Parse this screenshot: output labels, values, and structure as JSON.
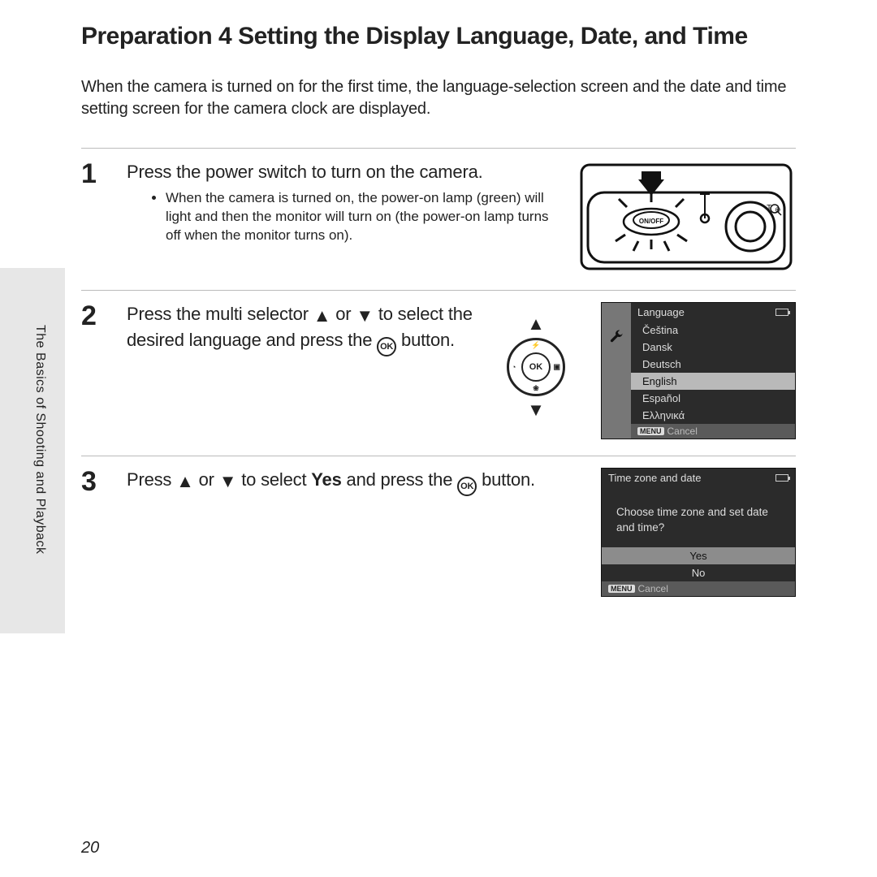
{
  "side_label": "The Basics of Shooting and Playback",
  "page_number": "20",
  "title": "Preparation 4 Setting the Display Language, Date, and Time",
  "intro": "When the camera is turned on for the first time, the language-selection screen and the date and time setting screen for the camera clock are displayed.",
  "steps": {
    "s1": {
      "num": "1",
      "heading": "Press the power switch to turn on the camera.",
      "bullet": "When the camera is turned on, the power-on lamp (green) will light and then the monitor will turn on (the power-on lamp turns off when the monitor turns on).",
      "onoff_label": "ON/OFF"
    },
    "s2": {
      "num": "2",
      "heading_a": "Press the multi selector ",
      "heading_b": " or ",
      "heading_c": " to select the desired language and press the ",
      "heading_d": " button.",
      "ok_label": "OK",
      "tri_up": "▲",
      "tri_down": "▼",
      "selector_ok": "OK",
      "lang_title": "Language",
      "lang_items": [
        "Čeština",
        "Dansk",
        "Deutsch",
        "English",
        "Español",
        "Ελληνικά"
      ],
      "lang_selected_index": 3,
      "cancel_label": "Cancel",
      "menu_pill": "MENU"
    },
    "s3": {
      "num": "3",
      "heading_a": "Press ",
      "heading_b": " or ",
      "heading_c": " to select ",
      "yes_word": "Yes",
      "heading_d": " and press the ",
      "heading_e": " button.",
      "ok_label": "OK",
      "tri_up": "▲",
      "tri_down": "▼",
      "tz_title": "Time zone and date",
      "tz_prompt": "Choose time zone and set date and time?",
      "tz_yes": "Yes",
      "tz_no": "No",
      "cancel_label": "Cancel",
      "menu_pill": "MENU"
    }
  }
}
